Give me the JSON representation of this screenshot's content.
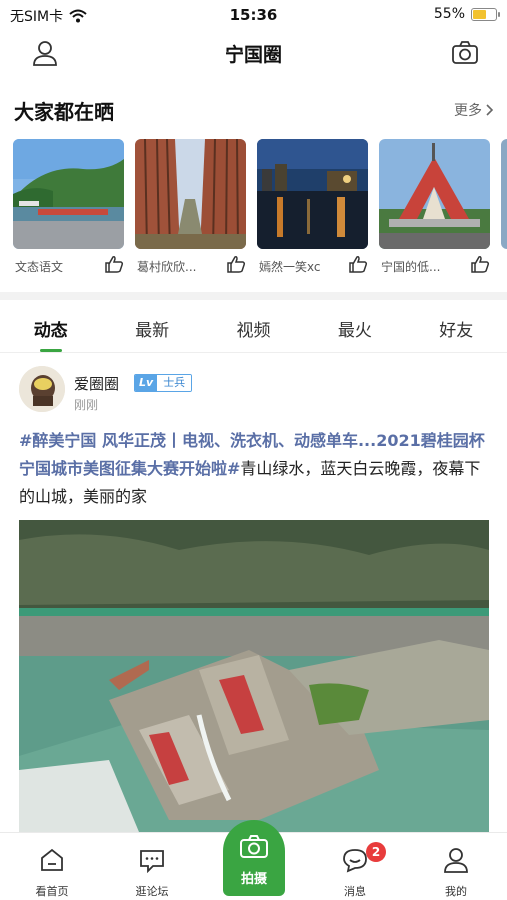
{
  "status_bar": {
    "carrier": "无SIM卡",
    "time": "15:36",
    "battery_text": "55%",
    "battery_level": 0.55
  },
  "nav": {
    "title": "宁国圈"
  },
  "shared": {
    "title": "大家都在晒",
    "more_label": "更多",
    "items": [
      {
        "caption": "文态语文"
      },
      {
        "caption": "葛村欣欣..."
      },
      {
        "caption": "嫣然一笑xc"
      },
      {
        "caption": "宁国的低..."
      }
    ]
  },
  "tabs": [
    {
      "label": "动态"
    },
    {
      "label": "最新"
    },
    {
      "label": "视频"
    },
    {
      "label": "最火"
    },
    {
      "label": "好友"
    }
  ],
  "post": {
    "author": "爱圈圈",
    "rank_level": "Lv",
    "rank_name": "士兵",
    "time": "刚刚",
    "topic": "#醉美宁国 风华正茂丨电视、洗衣机、动感单车...2021碧桂园杯宁国城市美图征集大赛开始啦#",
    "body": "青山绿水，蓝天白云晚霞，夜幕下的山城，美丽的家"
  },
  "bottom_nav": {
    "home": "看首页",
    "forum": "逛论坛",
    "shoot": "拍摄",
    "messages": "消息",
    "messages_badge": "2",
    "mine": "我的"
  },
  "colors": {
    "accent": "#3aa542",
    "topic": "#5a6fa6",
    "badge": "#e83c3c",
    "rank": "#5aa5e6"
  }
}
